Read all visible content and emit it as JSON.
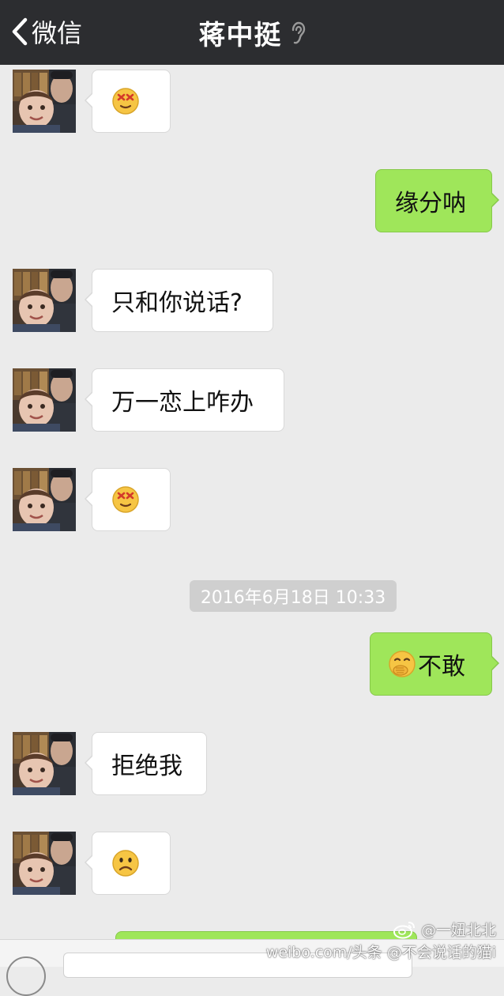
{
  "navbar": {
    "back_label": "微信",
    "title": "蒋中挺",
    "icons": {
      "back": "chevron-left-icon",
      "earpiece": "ear-icon"
    }
  },
  "messages": [
    {
      "side": "left",
      "type": "emoji",
      "emoji": "dizzy-eyes-emoji"
    },
    {
      "side": "right",
      "type": "text",
      "text": "缘分呐"
    },
    {
      "side": "left",
      "type": "text",
      "text": "只和你说话?"
    },
    {
      "side": "left",
      "type": "text",
      "text": "万一恋上咋办"
    },
    {
      "side": "left",
      "type": "emoji",
      "emoji": "dizzy-eyes-emoji"
    },
    {
      "side": "right",
      "type": "text-emoji",
      "emoji": "hand-over-mouth-emoji",
      "text": "不敢"
    },
    {
      "side": "left",
      "type": "text",
      "text": "拒绝我"
    },
    {
      "side": "left",
      "type": "emoji",
      "emoji": "frowning-face-emoji"
    }
  ],
  "timestamp": "2016年6月18日 10:33",
  "watermark": {
    "line1": "@一妞北北",
    "line2": "weibo.com/头条 @不会说话的猫i"
  },
  "colors": {
    "navbar_bg": "#2c2d30",
    "chat_bg": "#ebebeb",
    "bubble_left": "#ffffff",
    "bubble_right": "#9fe65a"
  }
}
